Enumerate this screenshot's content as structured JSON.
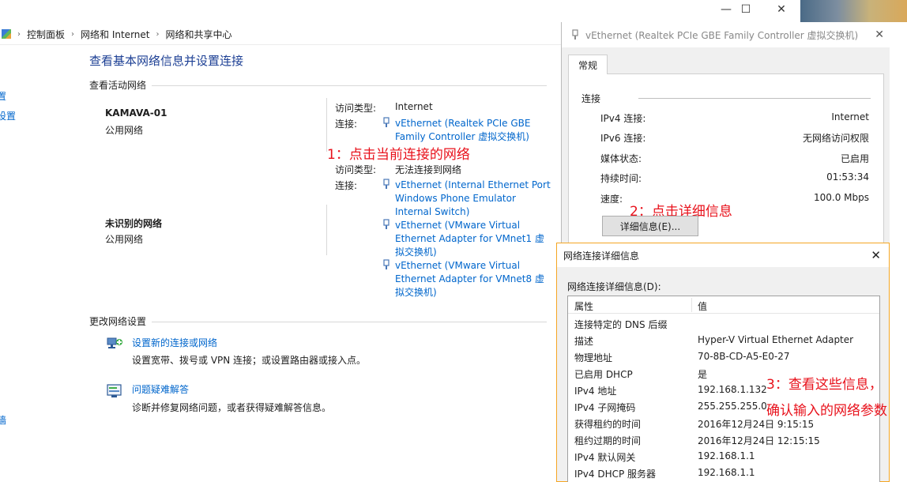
{
  "window_controls": {
    "minimize": "—",
    "maximize": "☐",
    "close": "✕"
  },
  "breadcrumb": {
    "items": [
      "控制面板",
      "网络和 Internet",
      "网络和共享中心"
    ],
    "sep": "›"
  },
  "main": {
    "page_title": "查看基本网络信息并设置连接",
    "active_networks_label": "查看活动网络",
    "left_edge_fragments": [
      "置",
      "设置",
      "墙"
    ],
    "networks": [
      {
        "name": "KAMAVA-01",
        "type": "公用网络",
        "access_label": "访问类型:",
        "access_value": "Internet",
        "conn_label": "连接:",
        "conn_lines": [
          "vEthernet (Realtek PCIe GBE",
          "Family Controller 虚拟交换机)"
        ]
      },
      {
        "name": "未识别的网络",
        "type": "公用网络",
        "access_label": "访问类型:",
        "access_value": "无法连接到网络",
        "conn_label": "连接:",
        "connections": [
          [
            "vEthernet (Internal Ethernet Port",
            "Windows Phone Emulator",
            "Internal Switch)"
          ],
          [
            "vEthernet (VMware Virtual",
            "Ethernet Adapter for VMnet1 虚",
            "拟交换机)"
          ],
          [
            "vEthernet (VMware Virtual",
            "Ethernet Adapter for VMnet8 虚",
            "拟交换机)"
          ]
        ]
      }
    ],
    "change_settings_label": "更改网络设置",
    "tasks": [
      {
        "icon": "setup-network-icon",
        "link": "设置新的连接或网络",
        "desc": "设置宽带、拨号或 VPN 连接；或设置路由器或接入点。"
      },
      {
        "icon": "troubleshoot-icon",
        "link": "问题疑难解答",
        "desc": "诊断并修复网络问题，或者获得疑难解答信息。"
      }
    ]
  },
  "annotations": {
    "step1": "1：点击当前连接的网络",
    "step2": "2：点击详细信息",
    "step3_line1": "3：查看这些信息，",
    "step3_line2": "确认输入的网络参数"
  },
  "props_dialog": {
    "title": "vEthernet (Realtek PCIe GBE Family Controller 虚拟交换机) ...",
    "close": "✕",
    "tab": "常规",
    "section": "连接",
    "rows": [
      {
        "k": "IPv4 连接:",
        "v": "Internet"
      },
      {
        "k": "IPv6 连接:",
        "v": "无网络访问权限"
      },
      {
        "k": "媒体状态:",
        "v": "已启用"
      },
      {
        "k": "持续时间:",
        "v": "01:53:34"
      },
      {
        "k": "速度:",
        "v": "100.0 Mbps"
      }
    ],
    "details_button": "详细信息(E)..."
  },
  "details_dialog": {
    "title": "网络连接详细信息",
    "close": "✕",
    "label": "网络连接详细信息(D):",
    "col_property": "属性",
    "col_value": "值",
    "rows": [
      {
        "p": "连接特定的 DNS 后缀",
        "v": ""
      },
      {
        "p": "描述",
        "v": "Hyper-V Virtual Ethernet Adapter"
      },
      {
        "p": "物理地址",
        "v": "70-8B-CD-A5-E0-27"
      },
      {
        "p": "已启用 DHCP",
        "v": "是"
      },
      {
        "p": "IPv4 地址",
        "v": "192.168.1.132"
      },
      {
        "p": "IPv4 子网掩码",
        "v": "255.255.255.0"
      },
      {
        "p": "获得租约的时间",
        "v": "2016年12月24日 9:15:15"
      },
      {
        "p": "租约过期的时间",
        "v": "2016年12月24日 12:15:15"
      },
      {
        "p": "IPv4 默认网关",
        "v": "192.168.1.1"
      },
      {
        "p": "IPv4 DHCP 服务器",
        "v": "192.168.1.1"
      }
    ]
  },
  "colors": {
    "link": "#0066cc",
    "annotation": "#e8111b",
    "dialog_border": "#f5a623"
  }
}
